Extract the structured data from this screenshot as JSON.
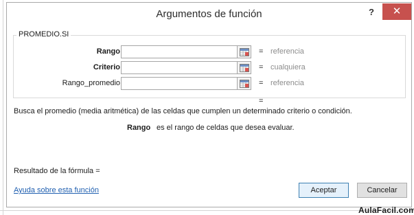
{
  "dialog": {
    "title": "Argumentos de función",
    "help_symbol": "?",
    "close_symbol": "✕",
    "function_name": "PROMEDIO.SI",
    "arguments": [
      {
        "label": "Rango",
        "value": "",
        "equals": "=",
        "hint": "referencia"
      },
      {
        "label": "Criterio",
        "value": "",
        "equals": "=",
        "hint": "cualquiera"
      },
      {
        "label": "Rango_promedio",
        "value": "",
        "equals": "=",
        "hint": "referencia"
      }
    ],
    "result_equals": "=",
    "description": "Busca el promedio (media aritmética) de las celdas que cumplen un determinado criterio o condición.",
    "arg_description_name": "Rango",
    "arg_description_text": "es el rango de celdas que desea evaluar.",
    "formula_result": "Resultado de la fórmula =",
    "help_link": "Ayuda sobre esta función",
    "ok_button": "Aceptar",
    "cancel_button": "Cancelar"
  },
  "watermark": "AulaFacil.com",
  "colors": {
    "close_button": "#c7514e",
    "link": "#1f5fb0",
    "hint_text": "#8c8c8c",
    "ok_border": "#3c7fb1"
  },
  "icons": {
    "ref_button": "range-selector-icon"
  }
}
